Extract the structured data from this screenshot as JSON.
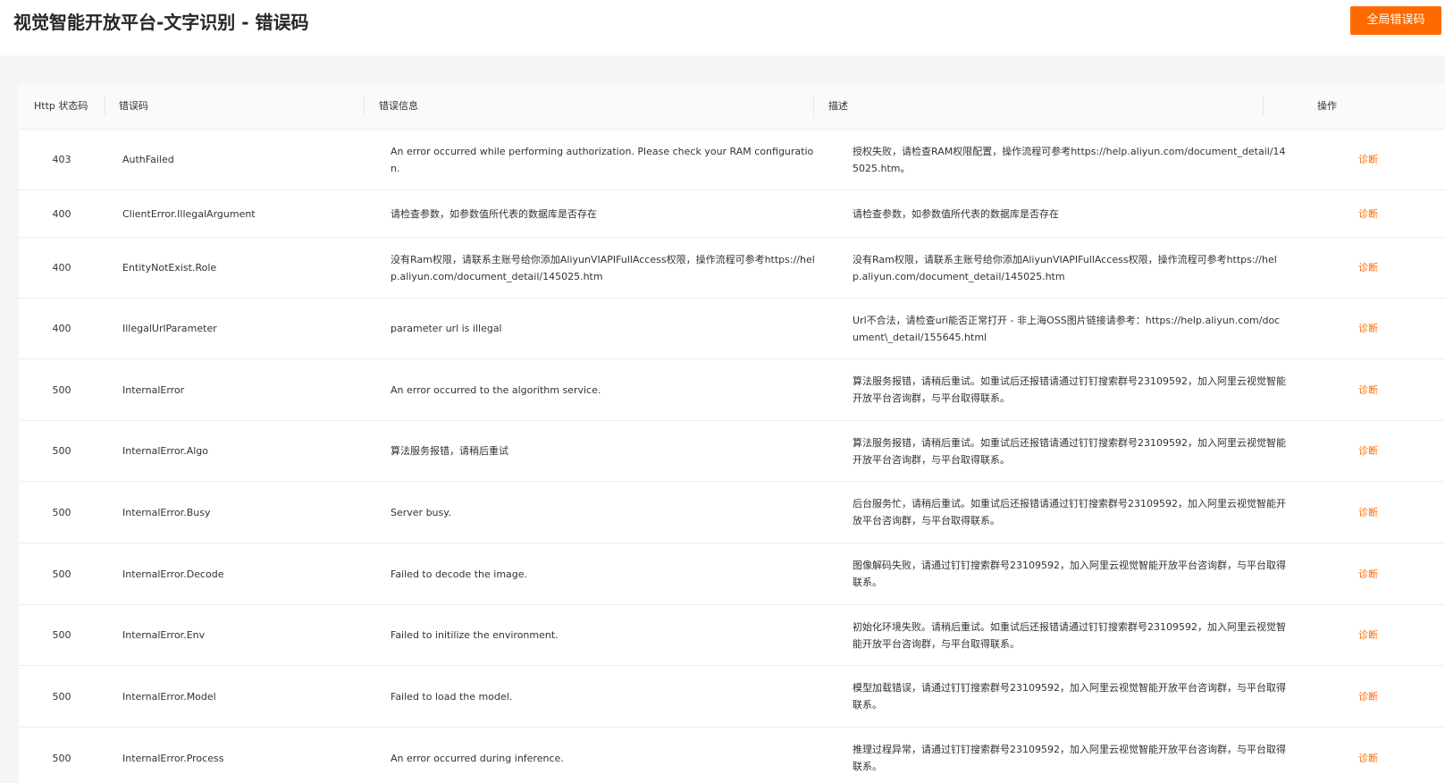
{
  "header": {
    "title": "视觉智能开放平台-文字识别 - 错误码",
    "global_button": "全局错误码"
  },
  "table": {
    "columns": {
      "status": "Http 状态码",
      "code": "错误码",
      "message": "错误信息",
      "description": "描述",
      "action": "操作"
    },
    "rows": [
      {
        "status": "403",
        "code": "AuthFailed",
        "message": "An error occurred while performing authorization. Please check your RAM configuration.",
        "description": "授权失败，请检查RAM权限配置，操作流程可参考https://help.aliyun.com/document_detail/145025.htm。",
        "action": "诊断"
      },
      {
        "status": "400",
        "code": "ClientError.IllegalArgument",
        "message": "请检查参数，如参数值所代表的数据库是否存在",
        "description": "请检查参数，如参数值所代表的数据库是否存在",
        "action": "诊断"
      },
      {
        "status": "400",
        "code": "EntityNotExist.Role",
        "message": "没有Ram权限，请联系主账号给你添加AliyunVIAPIFullAccess权限，操作流程可参考https://help.aliyun.com/document_detail/145025.htm",
        "description": "没有Ram权限，请联系主账号给你添加AliyunVIAPIFullAccess权限，操作流程可参考https://help.aliyun.com/document_detail/145025.htm",
        "action": "诊断"
      },
      {
        "status": "400",
        "code": "IllegalUrlParameter",
        "message": "parameter url is illegal",
        "description": "Url不合法，请检查url能否正常打开 - 非上海OSS图片链接请参考：https://help.aliyun.com/document\\_detail/155645.html",
        "action": "诊断"
      },
      {
        "status": "500",
        "code": "InternalError",
        "message": "An error occurred to the algorithm service.",
        "description": "算法服务报错，请稍后重试。如重试后还报错请通过钉钉搜索群号23109592，加入阿里云视觉智能开放平台咨询群，与平台取得联系。",
        "action": "诊断"
      },
      {
        "status": "500",
        "code": "InternalError.Algo",
        "message": "算法服务报错，请稍后重试",
        "description": "算法服务报错，请稍后重试。如重试后还报错请通过钉钉搜索群号23109592，加入阿里云视觉智能开放平台咨询群，与平台取得联系。",
        "action": "诊断"
      },
      {
        "status": "500",
        "code": "InternalError.Busy",
        "message": "Server busy.",
        "description": "后台服务忙，请稍后重试。如重试后还报错请通过钉钉搜索群号23109592，加入阿里云视觉智能开放平台咨询群，与平台取得联系。",
        "action": "诊断"
      },
      {
        "status": "500",
        "code": "InternalError.Decode",
        "message": "Failed to decode the image.",
        "description": "图像解码失败，请通过钉钉搜索群号23109592，加入阿里云视觉智能开放平台咨询群，与平台取得联系。",
        "action": "诊断"
      },
      {
        "status": "500",
        "code": "InternalError.Env",
        "message": "Failed to initilize the environment.",
        "description": "初始化环境失败。请稍后重试。如重试后还报错请通过钉钉搜索群号23109592，加入阿里云视觉智能开放平台咨询群，与平台取得联系。",
        "action": "诊断"
      },
      {
        "status": "500",
        "code": "InternalError.Model",
        "message": "Failed to load the model.",
        "description": "模型加载错误，请通过钉钉搜索群号23109592，加入阿里云视觉智能开放平台咨询群，与平台取得联系。",
        "action": "诊断"
      },
      {
        "status": "500",
        "code": "InternalError.Process",
        "message": "An error occurred during inference.",
        "description": "推理过程异常，请通过钉钉搜索群号23109592，加入阿里云视觉智能开放平台咨询群，与平台取得联系。",
        "action": "诊断"
      }
    ]
  },
  "colors": {
    "accent": "#ff6a00",
    "header_bg": "#fafafa",
    "page_bg": "#f5f5f5"
  }
}
